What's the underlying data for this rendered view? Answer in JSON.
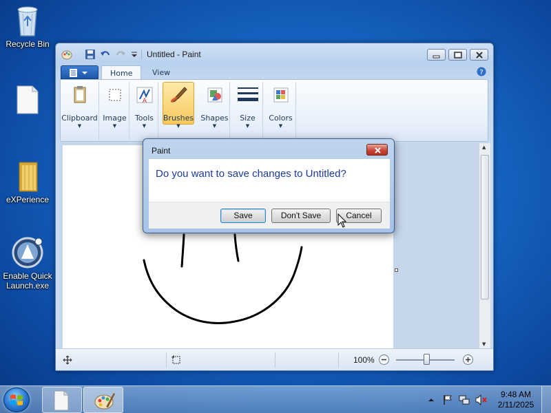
{
  "desktop": {
    "icons": [
      {
        "label": "Recycle Bin"
      },
      {
        "label": ""
      },
      {
        "label": "eXPerience"
      },
      {
        "label": "Enable Quick Launch.exe"
      }
    ]
  },
  "window": {
    "title": "Untitled - Paint",
    "tabs": [
      {
        "label": "Home"
      },
      {
        "label": "View"
      }
    ],
    "ribbon_groups": [
      {
        "label": "Clipboard"
      },
      {
        "label": "Image"
      },
      {
        "label": "Tools"
      },
      {
        "label": "Brushes"
      },
      {
        "label": "Shapes"
      },
      {
        "label": "Size"
      },
      {
        "label": "Colors"
      }
    ]
  },
  "status_bar": {
    "zoom": "100%"
  },
  "dialog": {
    "title": "Paint",
    "message": "Do you want to save changes to Untitled?",
    "buttons": {
      "save": "Save",
      "dont_save": "Don't Save",
      "cancel": "Cancel"
    }
  },
  "taskbar": {
    "time": "9:48 AM",
    "date": "2/11/2025"
  },
  "colors": {
    "accent": "#1767c4",
    "dialog_message": "#1b3a9b",
    "close_button": "#c8463a"
  }
}
